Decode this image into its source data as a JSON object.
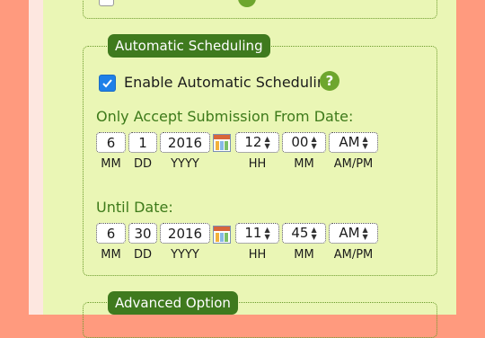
{
  "automatic_scheduling": {
    "legend": "Automatic Scheduling",
    "enable_label": "Enable Automatic Scheduling",
    "enable_checked": true,
    "help_symbol": "?",
    "from": {
      "heading": "Only Accept Submission From Date:",
      "month": "6",
      "day": "1",
      "year": "2016",
      "hour": "12",
      "minute": "00",
      "ampm": "AM"
    },
    "until": {
      "heading": "Until Date:",
      "month": "6",
      "day": "30",
      "year": "2016",
      "hour": "11",
      "minute": "45",
      "ampm": "AM"
    },
    "units": {
      "mm": "MM",
      "dd": "DD",
      "yyyy": "YYYY",
      "hh": "HH",
      "min": "MM",
      "ampm": "AM/PM"
    }
  },
  "advanced_option": {
    "legend": "Advanced Option"
  },
  "icons": [
    "checkbox-checked-icon",
    "help-icon",
    "calendar-icon",
    "select-arrows-icon"
  ],
  "colors": {
    "legend_bg": "#3f7a1e",
    "panel_bg": "#eaf6b5",
    "heading": "#3d7a1a",
    "checkbox": "#1f80e8"
  }
}
